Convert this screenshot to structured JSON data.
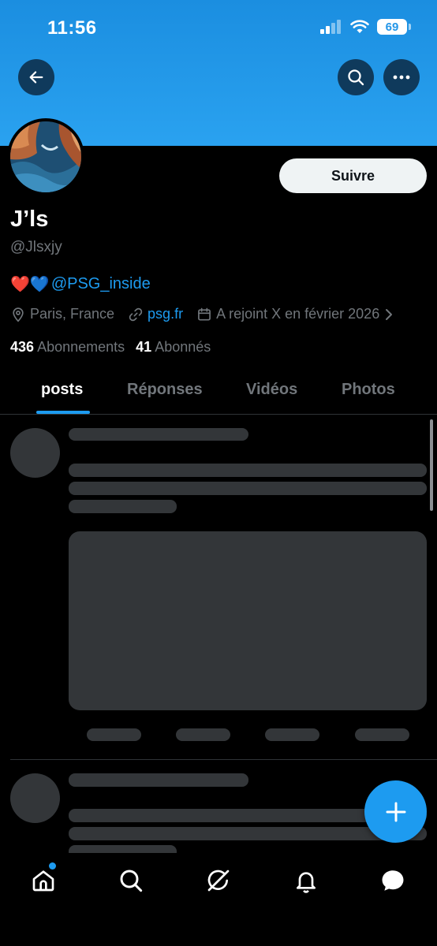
{
  "status_bar": {
    "time": "11:56",
    "battery": "69"
  },
  "profile": {
    "display_name": "J’ls",
    "handle": "@Jlsxjy",
    "bio_emojis": "❤️💙",
    "bio_mention": "@PSG_inside",
    "location": "Paris, France",
    "website": "psg.fr",
    "joined": "A rejoint X en février 2026",
    "following_count": "436",
    "following_label": "Abonnements",
    "followers_count": "41",
    "followers_label": "Abonnés",
    "follow_button": "Suivre"
  },
  "tabs": [
    {
      "label": "posts",
      "active": true
    },
    {
      "label": "Réponses",
      "active": false
    },
    {
      "label": "Vidéos",
      "active": false
    },
    {
      "label": "Photos",
      "active": false
    }
  ],
  "colors": {
    "accent": "#1d9bf0",
    "banner": "#2aa2f0",
    "skeleton": "#333639",
    "background": "#000000"
  },
  "icons": {
    "back": "arrow-left-icon",
    "search": "search-icon",
    "more": "more-icon",
    "location": "map-pin-icon",
    "website": "link-icon",
    "joined": "calendar-icon",
    "expand": "chevron-right-icon",
    "compose": "plus-icon",
    "nav": [
      "home-icon",
      "search-icon",
      "grok-icon",
      "bell-icon",
      "chat-icon"
    ]
  }
}
